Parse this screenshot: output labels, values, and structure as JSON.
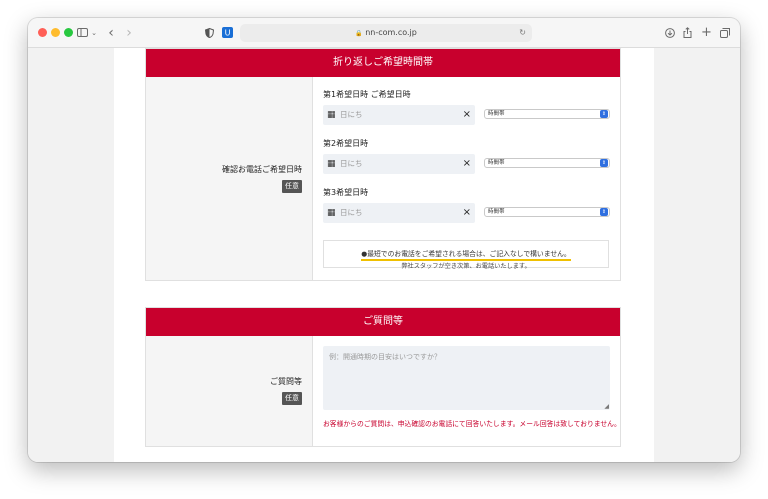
{
  "browser": {
    "url": "nn-com.co.jp",
    "icons": [
      "sidebar-icon",
      "chevron-down-icon",
      "back-icon",
      "forward-icon",
      "shield-icon",
      "password-extension-icon",
      "lock-icon",
      "reload-icon",
      "download-icon",
      "share-icon",
      "plus-icon",
      "tabs-icon"
    ]
  },
  "colors": {
    "accent": "#c8002d",
    "highlight": "#f0c000",
    "select_arrow": "#2f6fe0"
  },
  "callback_section": {
    "title": "折り返しご希望時間帯",
    "field_label": "確認お電話ご希望日時",
    "badge": "任意",
    "rows": [
      {
        "label": "第1希望日時 ご希望日時",
        "date_placeholder": "日にち",
        "clear": "×",
        "time_select": "時間帯"
      },
      {
        "label": "第2希望日時",
        "date_placeholder": "日にち",
        "clear": "×",
        "time_select": "時間帯"
      },
      {
        "label": "第3希望日時",
        "date_placeholder": "日にち",
        "clear": "×",
        "time_select": "時間帯"
      }
    ],
    "note_line1": "●最短でのお電話をご希望される場合は、ご記入なしで構いません。",
    "note_line2": "弊社スタッフが空き次第、お電話いたします。"
  },
  "question_section": {
    "title": "ご質問等",
    "field_label": "ご質問等",
    "badge": "任意",
    "textarea_placeholder": "例：開通時期の目安はいつですか？",
    "note": "お客様からのご質問は、申込確認のお電話にて回答いたします。メール回答は致しておりません。"
  }
}
